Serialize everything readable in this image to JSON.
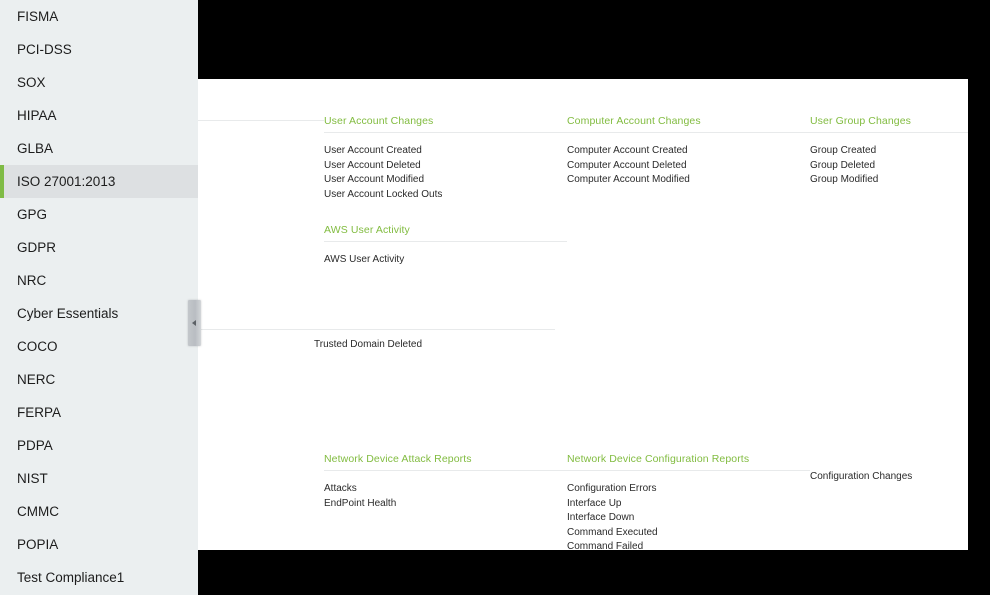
{
  "sidebar": {
    "items": [
      {
        "label": "FISMA",
        "active": false
      },
      {
        "label": "PCI-DSS",
        "active": false
      },
      {
        "label": "SOX",
        "active": false
      },
      {
        "label": "HIPAA",
        "active": false
      },
      {
        "label": "GLBA",
        "active": false
      },
      {
        "label": "ISO 27001:2013",
        "active": true
      },
      {
        "label": "GPG",
        "active": false
      },
      {
        "label": "GDPR",
        "active": false
      },
      {
        "label": "NRC",
        "active": false
      },
      {
        "label": "Cyber Essentials",
        "active": false
      },
      {
        "label": "COCO",
        "active": false
      },
      {
        "label": "NERC",
        "active": false
      },
      {
        "label": "FERPA",
        "active": false
      },
      {
        "label": "PDPA",
        "active": false
      },
      {
        "label": "NIST",
        "active": false
      },
      {
        "label": "CMMC",
        "active": false
      },
      {
        "label": "POPIA",
        "active": false
      },
      {
        "label": "Test Compliance1",
        "active": false
      }
    ]
  },
  "collapse_handle": {
    "icon": "chevron-left-icon"
  },
  "colors": {
    "accent_green": "#82bc41",
    "sidebar_bg": "#ebeff0",
    "sidebar_active_bg": "#dde0e2",
    "panel_bg": "#ffffff",
    "backdrop": "#000000",
    "rule": "#e8eaeb"
  },
  "content": {
    "band1": {
      "col1": {
        "blocks": [
          {
            "title": "",
            "items": []
          }
        ]
      },
      "col2": {
        "blocks": [
          {
            "title": "User Account Changes",
            "items": [
              "User Account Created",
              "User Account Deleted",
              "User Account Modified",
              "User Account Locked Outs"
            ]
          },
          {
            "title": "AWS User Activity",
            "items": [
              "AWS User Activity"
            ]
          }
        ]
      },
      "col3": {
        "blocks": [
          {
            "title": "Computer Account Changes",
            "items": [
              "Computer Account Created",
              "Computer Account Deleted",
              "Computer Account Modified"
            ]
          }
        ]
      },
      "col4": {
        "blocks": [
          {
            "title": "User Group Changes",
            "items": [
              "Group Created",
              "Group Deleted",
              "Group Modified"
            ]
          }
        ]
      }
    },
    "band2": {
      "col2": {
        "items": [
          "Trusted Domain Deleted"
        ]
      }
    },
    "band3": {
      "col2": {
        "title": "Network Device Attack Reports",
        "items": [
          "Attacks",
          "EndPoint Health"
        ]
      },
      "col3": {
        "title": "Network Device Configuration Reports",
        "items": [
          "Configuration Errors",
          "Interface Up",
          "Interface Down",
          "Command Executed",
          "Command Failed"
        ]
      },
      "col4": {
        "items": [
          "Configuration Changes"
        ]
      }
    }
  }
}
